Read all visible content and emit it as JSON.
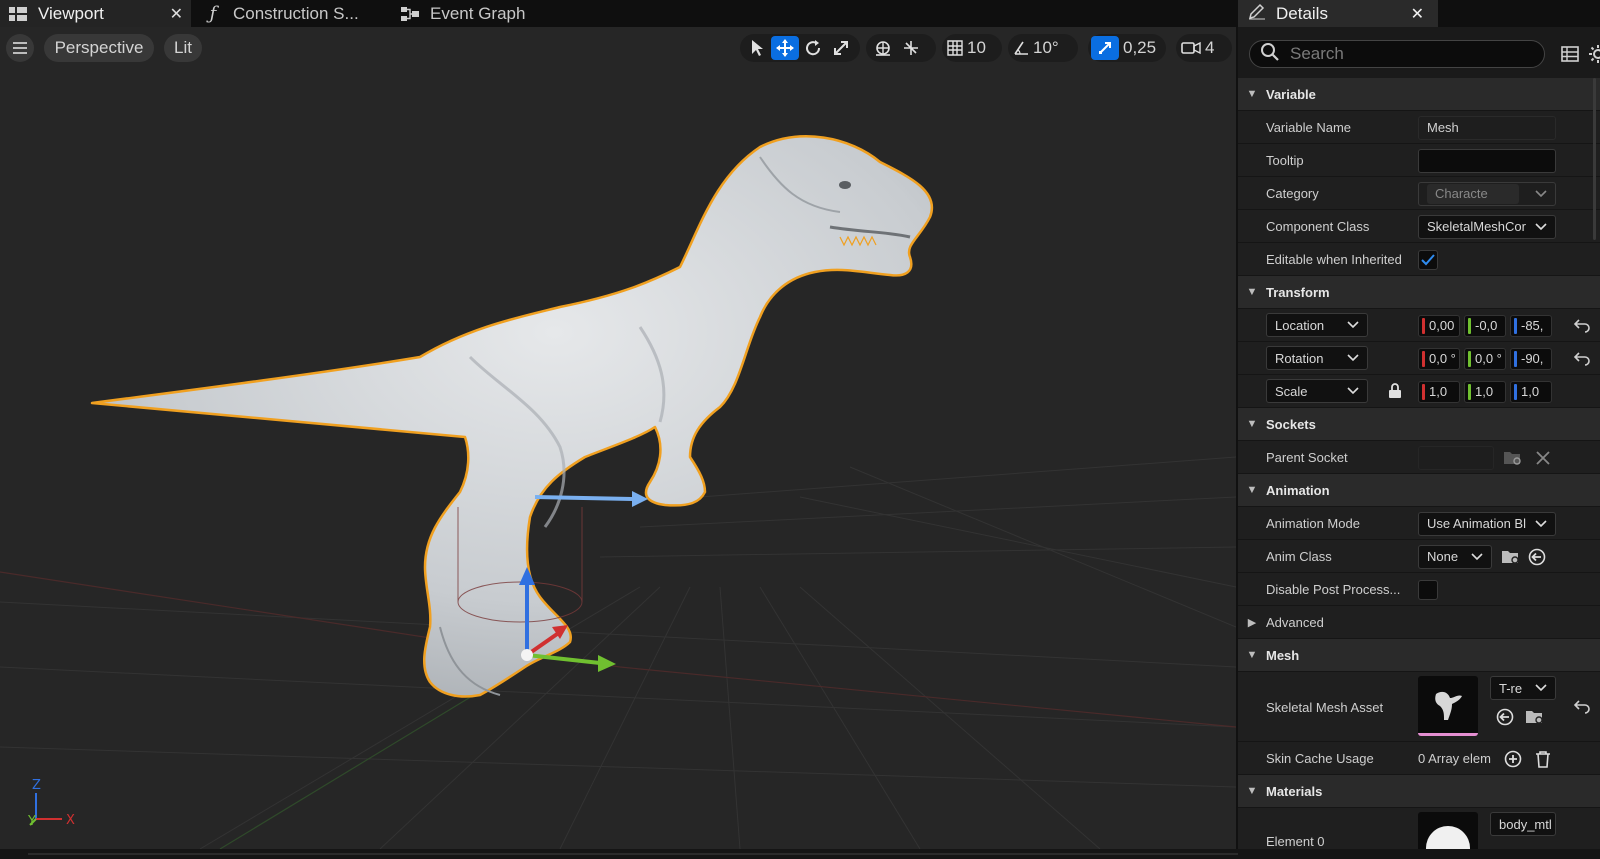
{
  "tabs": {
    "viewport": "Viewport",
    "construction": "Construction S...",
    "event_graph": "Event Graph"
  },
  "viewport_toolbar": {
    "perspective": "Perspective",
    "lit": "Lit",
    "grid_snap": "10",
    "rotation_snap": "10°",
    "scale_snap": "0,25",
    "camera_speed": "4"
  },
  "axis_indicator": {
    "z": "Z",
    "y": "Y",
    "x": "X"
  },
  "details": {
    "title": "Details",
    "search_placeholder": "Search",
    "categories": {
      "variable": "Variable",
      "transform": "Transform",
      "sockets": "Sockets",
      "animation": "Animation",
      "advanced": "Advanced",
      "mesh": "Mesh",
      "materials": "Materials"
    },
    "variable": {
      "name_label": "Variable Name",
      "name_value": "Mesh",
      "tooltip_label": "Tooltip",
      "tooltip_value": "",
      "category_label": "Category",
      "category_value": "Characte",
      "component_class_label": "Component Class",
      "component_class_value": "SkeletalMeshCor",
      "editable_label": "Editable when Inherited"
    },
    "transform": {
      "location_label": "Location",
      "location": [
        "0,00",
        "-0,0",
        "-85,"
      ],
      "rotation_label": "Rotation",
      "rotation": [
        "0,0 °",
        "0,0 °",
        "-90,"
      ],
      "scale_label": "Scale",
      "scale": [
        "1,0",
        "1,0",
        "1,0"
      ]
    },
    "sockets": {
      "parent_socket_label": "Parent Socket"
    },
    "animation": {
      "mode_label": "Animation Mode",
      "mode_value": "Use Animation Bl",
      "anim_class_label": "Anim Class",
      "anim_class_value": "None",
      "disable_pp_label": "Disable Post Process..."
    },
    "mesh": {
      "skeletal_mesh_label": "Skeletal Mesh Asset",
      "skeletal_mesh_value": "T-re",
      "skin_cache_label": "Skin Cache Usage",
      "skin_cache_value": "0 Array elem"
    },
    "materials": {
      "element_label": "Element 0",
      "element_value": "body_mtl"
    }
  },
  "colors": {
    "accent": "#0a6ee1",
    "selection_outline": "#f0a020",
    "axis_x": "#d03030",
    "axis_y": "#70c030",
    "axis_z": "#3070e0"
  }
}
